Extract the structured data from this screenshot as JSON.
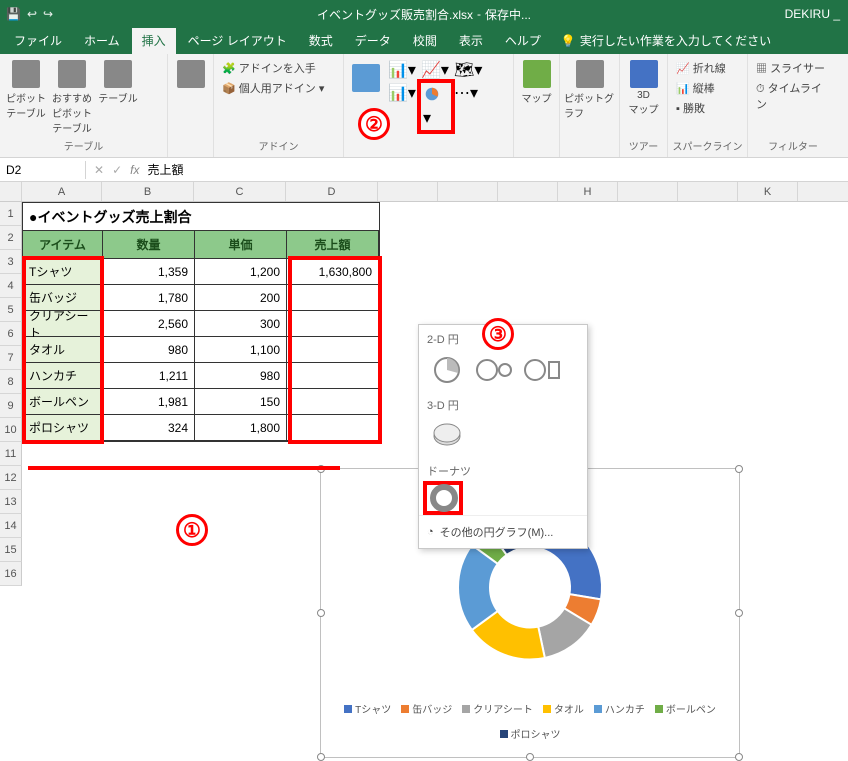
{
  "title": {
    "filename": "イベントグッズ販売割合.xlsx",
    "state": "保存中...",
    "user": "DEKIRU _"
  },
  "tabs": {
    "file": "ファイル",
    "home": "ホーム",
    "insert": "挿入",
    "layout": "ページ レイアウト",
    "formulas": "数式",
    "data": "データ",
    "review": "校閲",
    "view": "表示",
    "help": "ヘルプ",
    "tell": "実行したい作業を入力してください"
  },
  "ribbon": {
    "tables": {
      "pivot": "ピボット\nテーブル",
      "reco": "おすすめ\nピボットテーブル",
      "table": "テーブル",
      "label": "テーブル"
    },
    "addins": {
      "get": "アドインを入手",
      "my": "個人用アドイン",
      "label": "アドイン"
    },
    "charts": {
      "map": "マップ",
      "pivotchart": "ピボットグラフ"
    },
    "tour": {
      "map3d": "3D\nマップ",
      "label": "ツアー"
    },
    "spark": {
      "line": "折れ線",
      "col": "縦棒",
      "wl": "勝敗",
      "label": "スパークライン"
    },
    "filter": {
      "slicer": "スライサー",
      "timeline": "タイムライン",
      "label": "フィルター"
    }
  },
  "piemenu": {
    "s2d": "2-D 円",
    "s3d": "3-D 円",
    "donut": "ドーナツ",
    "more": "その他の円グラフ(M)..."
  },
  "namebox": "D2",
  "formula": "売上額",
  "cols": [
    "A",
    "B",
    "C",
    "D",
    "",
    "",
    "",
    "H",
    "",
    "",
    "K"
  ],
  "rows": [
    "1",
    "2",
    "3",
    "4",
    "5",
    "6",
    "7",
    "8",
    "9",
    "10",
    "11",
    "12",
    "13",
    "14",
    "15",
    "16"
  ],
  "table": {
    "title": "●イベントグッズ売上割合",
    "headers": [
      "アイテム",
      "数量",
      "単価",
      "売上額"
    ],
    "data": [
      [
        "Tシャツ",
        "1,359",
        "1,200",
        "1,630,800"
      ],
      [
        "缶バッジ",
        "1,780",
        "200",
        ""
      ],
      [
        "クリアシート",
        "2,560",
        "300",
        ""
      ],
      [
        "タオル",
        "980",
        "1,100",
        ""
      ],
      [
        "ハンカチ",
        "1,211",
        "980",
        ""
      ],
      [
        "ボールペン",
        "1,981",
        "150",
        ""
      ],
      [
        "ポロシャツ",
        "324",
        "1,800",
        ""
      ]
    ]
  },
  "annotations": {
    "n1": "①",
    "n2": "②",
    "n3": "③"
  },
  "chart_data": {
    "type": "doughnut",
    "title": "",
    "categories": [
      "Tシャツ",
      "缶バッジ",
      "クリアシート",
      "タオル",
      "ハンカチ",
      "ボールペン",
      "ポロシャツ"
    ],
    "values": [
      1630800,
      356000,
      768000,
      1078000,
      1186780,
      297150,
      583200
    ],
    "colors": [
      "#4472c4",
      "#ed7d31",
      "#a5a5a5",
      "#ffc000",
      "#5b9bd5",
      "#70ad47",
      "#264478"
    ]
  }
}
